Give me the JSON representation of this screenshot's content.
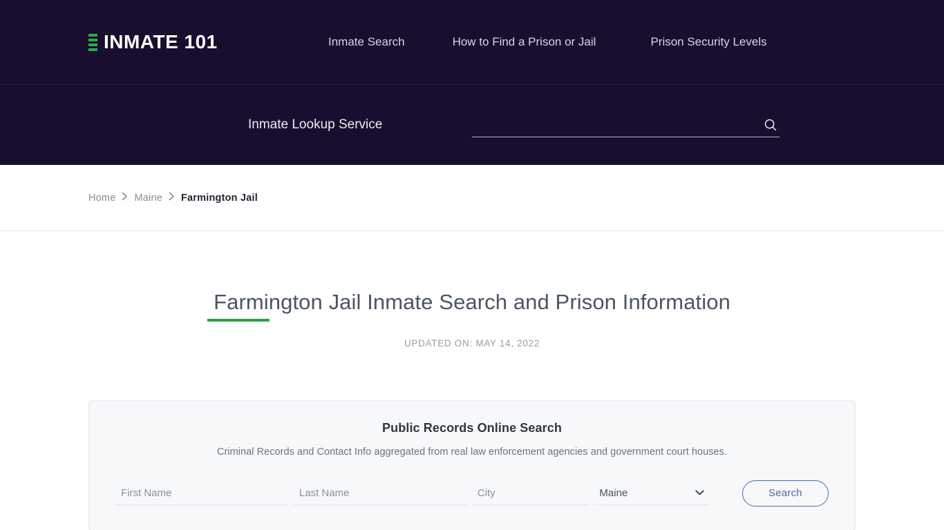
{
  "header": {
    "brand": {
      "text": "INMATE 101",
      "mark_color": "#2eab4e"
    },
    "nav": [
      {
        "label": "Inmate Search"
      },
      {
        "label": "How to Find a Prison or Jail"
      },
      {
        "label": "Prison Security Levels"
      }
    ],
    "lookup_label": "Inmate Lookup Service",
    "search": {
      "value": "",
      "placeholder": ""
    },
    "background_color": "#190e2e"
  },
  "breadcrumb": {
    "separator": "›",
    "items": [
      {
        "label": "Home",
        "current": false
      },
      {
        "label": "Maine",
        "current": false
      },
      {
        "label": "Farmington Jail",
        "current": true
      }
    ]
  },
  "main": {
    "title": "Farmington Jail Inmate Search and Prison Information",
    "title_rule_color": "#25a244",
    "updated_on": "UPDATED ON: MAY 14, 2022"
  },
  "records_card": {
    "title": "Public Records Online Search",
    "subtitle": "Criminal Records and Contact Info aggregated from real law enforcement agencies and government court houses.",
    "fields": {
      "first_name": {
        "placeholder": "First Name",
        "value": ""
      },
      "last_name": {
        "placeholder": "Last Name",
        "value": ""
      },
      "city": {
        "placeholder": "City",
        "value": ""
      },
      "state": {
        "selected": "Maine",
        "options": [
          "Maine"
        ]
      }
    },
    "submit_label": "Search",
    "submit_color": "#4a6fa5"
  }
}
